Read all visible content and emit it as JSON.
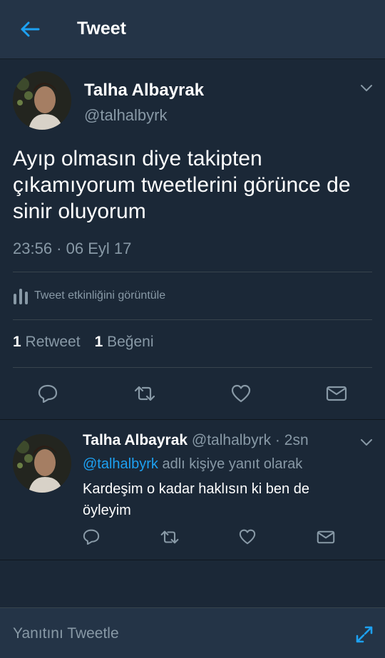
{
  "header": {
    "title": "Tweet",
    "back_icon": "arrow-left-icon"
  },
  "main_tweet": {
    "author_name": "Talha Albayrak",
    "author_handle": "@talhalbyrk",
    "text": "Ayıp olmasın diye takipten çıkamıyorum tweetlerini görünce de sinir oluyorum",
    "timestamp": "23:56 · 06 Eyl 17",
    "activity_label": "Tweet etkinliğini görüntüle",
    "retweet_count": "1",
    "retweet_label": "Retweet",
    "like_count": "1",
    "like_label": "Beğeni",
    "actions": [
      "reply-icon",
      "retweet-icon",
      "heart-icon",
      "mail-icon"
    ]
  },
  "reply": {
    "author_name": "Talha Albayrak",
    "handle_time": "@talhalbyrk · 2sn",
    "mention": "@talhalbyrk",
    "context_suffix": " adlı kişiye yanıt olarak",
    "text": "Kardeşim o kadar haklısın ki ben de öyleyim"
  },
  "composer": {
    "placeholder": "Yanıtını Tweetle",
    "expand_icon": "expand-icon"
  },
  "colors": {
    "background": "#1b2837",
    "header": "#243447",
    "accent": "#1da1f2",
    "secondary_text": "#8899a6"
  }
}
